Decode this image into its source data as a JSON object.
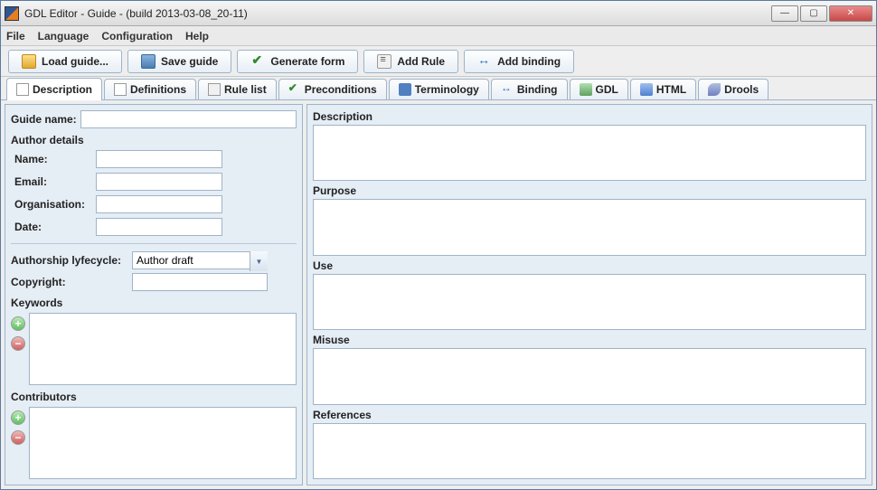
{
  "window": {
    "title": "GDL Editor - Guide - (build 2013-03-08_20-11)"
  },
  "menubar": {
    "file": "File",
    "language": "Language",
    "configuration": "Configuration",
    "help": "Help"
  },
  "toolbar": {
    "load": "Load guide...",
    "save": "Save guide",
    "generate": "Generate form",
    "addRule": "Add Rule",
    "addBinding": "Add binding"
  },
  "tabs": {
    "description": "Description",
    "definitions": "Definitions",
    "ruleList": "Rule list",
    "preconditions": "Preconditions",
    "terminology": "Terminology",
    "binding": "Binding",
    "gdl": "GDL",
    "html": "HTML",
    "drools": "Drools"
  },
  "left": {
    "guideName": "Guide name:",
    "guideNameValue": "",
    "authorDetails": "Author details",
    "name": "Name:",
    "nameValue": "",
    "email": "Email:",
    "emailValue": "",
    "organisation": "Organisation:",
    "organisationValue": "",
    "date": "Date:",
    "dateValue": "",
    "lifecycle": "Authorship lyfecycle:",
    "lifecycleValue": "Author draft",
    "copyright": "Copyright:",
    "copyrightValue": "",
    "keywords": "Keywords",
    "contributors": "Contributors"
  },
  "right": {
    "description": "Description",
    "purpose": "Purpose",
    "use": "Use",
    "misuse": "Misuse",
    "references": "References"
  }
}
